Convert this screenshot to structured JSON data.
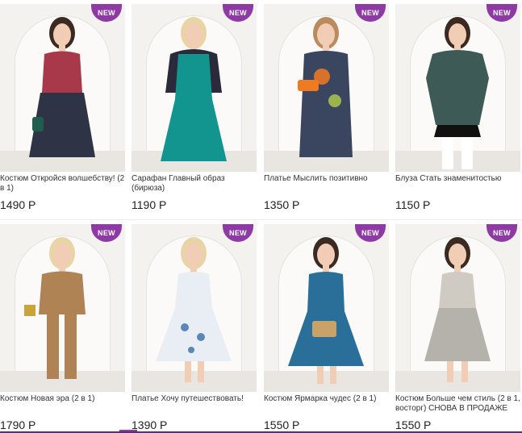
{
  "badge_label": "NEW",
  "badge_color": "#8d3aa5",
  "products": [
    {
      "name": "Костюм Откройся волшебству! (2 в 1)",
      "price": "1490 Р",
      "outfit_color": "#2e3446",
      "accent_color": "#a8394a"
    },
    {
      "name": "Сарафан Главный образ (бирюза)",
      "price": "1190 Р",
      "outfit_color": "#12958f",
      "accent_color": "#2b2a3a"
    },
    {
      "name": "Платье Мыслить позитивно",
      "price": "1350 Р",
      "outfit_color": "#3a4560",
      "accent_color": "#f07a1e"
    },
    {
      "name": "Блуза Стать знаменитостью",
      "price": "1150 Р",
      "outfit_color": "#3d5a56",
      "accent_color": "#ffffff"
    },
    {
      "name": "Костюм Новая эра (2 в 1)",
      "price": "1790 Р",
      "outfit_color": "#b08354",
      "accent_color": "#d9a86a"
    },
    {
      "name": "Платье Хочу путешествовать!",
      "price": "1390 Р",
      "outfit_color": "#e8eef4",
      "accent_color": "#5b86b5"
    },
    {
      "name": "Костюм Ярмарка чудес (2 в 1)",
      "price": "1550 Р",
      "outfit_color": "#2a6f99",
      "accent_color": "#c9a26a"
    },
    {
      "name": "Костюм Больше чем стиль (2 в 1, восторг) СНОВА В ПРОДАЖЕ",
      "price": "1550 Р",
      "outfit_color": "#cfcbc2",
      "accent_color": "#b5b2ab"
    }
  ]
}
